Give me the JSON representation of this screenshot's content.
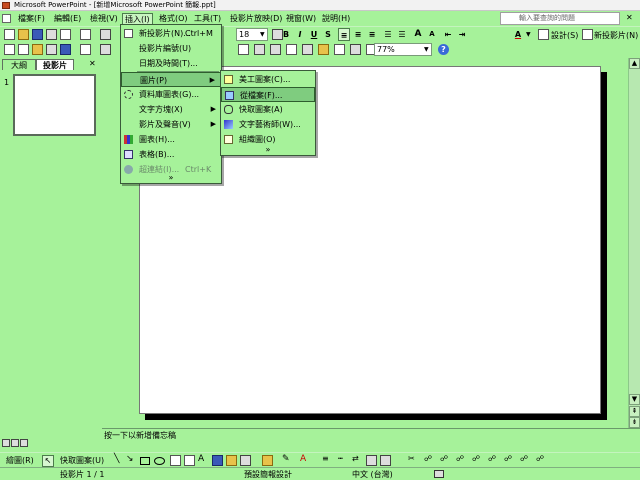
{
  "window": {
    "title": "Microsoft PowerPoint - [新增Microsoft PowerPoint 簡報.ppt]"
  },
  "menubar": {
    "items": [
      "檔案(F)",
      "編輯(E)",
      "檢視(V)",
      "插入(I)",
      "格式(O)",
      "工具(T)",
      "投影片放映(D)",
      "視窗(W)",
      "說明(H)"
    ],
    "help_placeholder": "輸入要查詢的問題"
  },
  "toolbar": {
    "font_size": "18",
    "design_label": "設計(S)",
    "new_slide_label": "新投影片(N)",
    "zoom": "77%"
  },
  "left_pane": {
    "tab_outline": "大綱",
    "tab_slides": "投影片",
    "slide_number": "1"
  },
  "insert_menu": {
    "items": [
      {
        "label": "新投影片(N)...",
        "shortcut": "Ctrl+M",
        "icon": "new-slide-icon"
      },
      {
        "label": "投影片編號(U)"
      },
      {
        "label": "日期及時間(T)..."
      },
      {
        "label": "圖片(P)",
        "submenu": true
      },
      {
        "label": "資料庫圖表(G)...",
        "icon": "diagram-icon"
      },
      {
        "label": "文字方塊(X)",
        "submenu": true
      },
      {
        "label": "影片及聲音(V)",
        "submenu": true
      },
      {
        "label": "圖表(H)...",
        "icon": "chart-icon"
      },
      {
        "label": "表格(B)...",
        "icon": "table-icon"
      },
      {
        "label": "超連結(I)...",
        "shortcut": "Ctrl+K",
        "disabled": true,
        "icon": "hyperlink-icon"
      }
    ],
    "more": "»"
  },
  "picture_submenu": {
    "items": [
      {
        "label": "美工圖案(C)...",
        "icon": "clipart-icon"
      },
      {
        "label": "從檔案(F)...",
        "icon": "from-file-icon"
      },
      {
        "label": "快取圖案(A)",
        "icon": "autoshapes-icon"
      },
      {
        "label": "文字藝術師(W)...",
        "icon": "wordart-icon"
      },
      {
        "label": "組織圖(O)",
        "icon": "org-chart-icon"
      }
    ],
    "more": "»"
  },
  "notes": {
    "placeholder": "按一下以新增備忘稿"
  },
  "drawing_toolbar": {
    "draw_label": "繪圖(R)",
    "autoshapes_label": "快取圖案(U)"
  },
  "statusbar": {
    "slide": "投影片 1 / 1",
    "design": "預設簡報設計",
    "language": "中文 (台灣)"
  },
  "colors": {
    "theme_green": "#a6f29a",
    "highlight": "#7fcc7f"
  }
}
